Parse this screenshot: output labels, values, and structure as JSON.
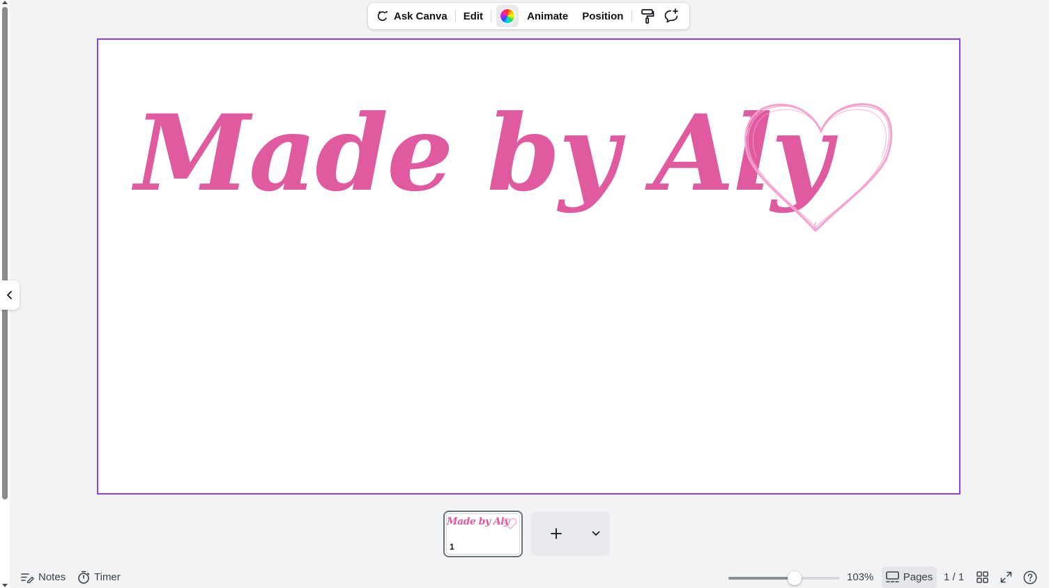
{
  "toolbar": {
    "ask_canva_label": "Ask Canva",
    "edit_label": "Edit",
    "animate_label": "Animate",
    "position_label": "Position"
  },
  "canvas": {
    "heading": "Made by Aly",
    "accent_color": "#e05aa0",
    "heart_color": "#f4a3cf",
    "selection_color": "#8b3dff"
  },
  "page_strip": {
    "thumbnail_text": "Made by Aly",
    "page_number": "1"
  },
  "footer": {
    "notes_label": "Notes",
    "timer_label": "Timer",
    "zoom_value": 103,
    "zoom_label": "103%",
    "pages_label": "Pages",
    "page_count": "1 / 1"
  },
  "icons": {
    "ask_canva": "ai-sparkle-icon",
    "copy_style": "paint-roller-icon",
    "comment": "add-comment-icon",
    "notes": "notes-icon",
    "timer": "timer-icon",
    "pages": "pages-layout-icon",
    "grid": "grid-view-icon",
    "fullscreen": "fullscreen-icon",
    "help": "help-icon"
  }
}
